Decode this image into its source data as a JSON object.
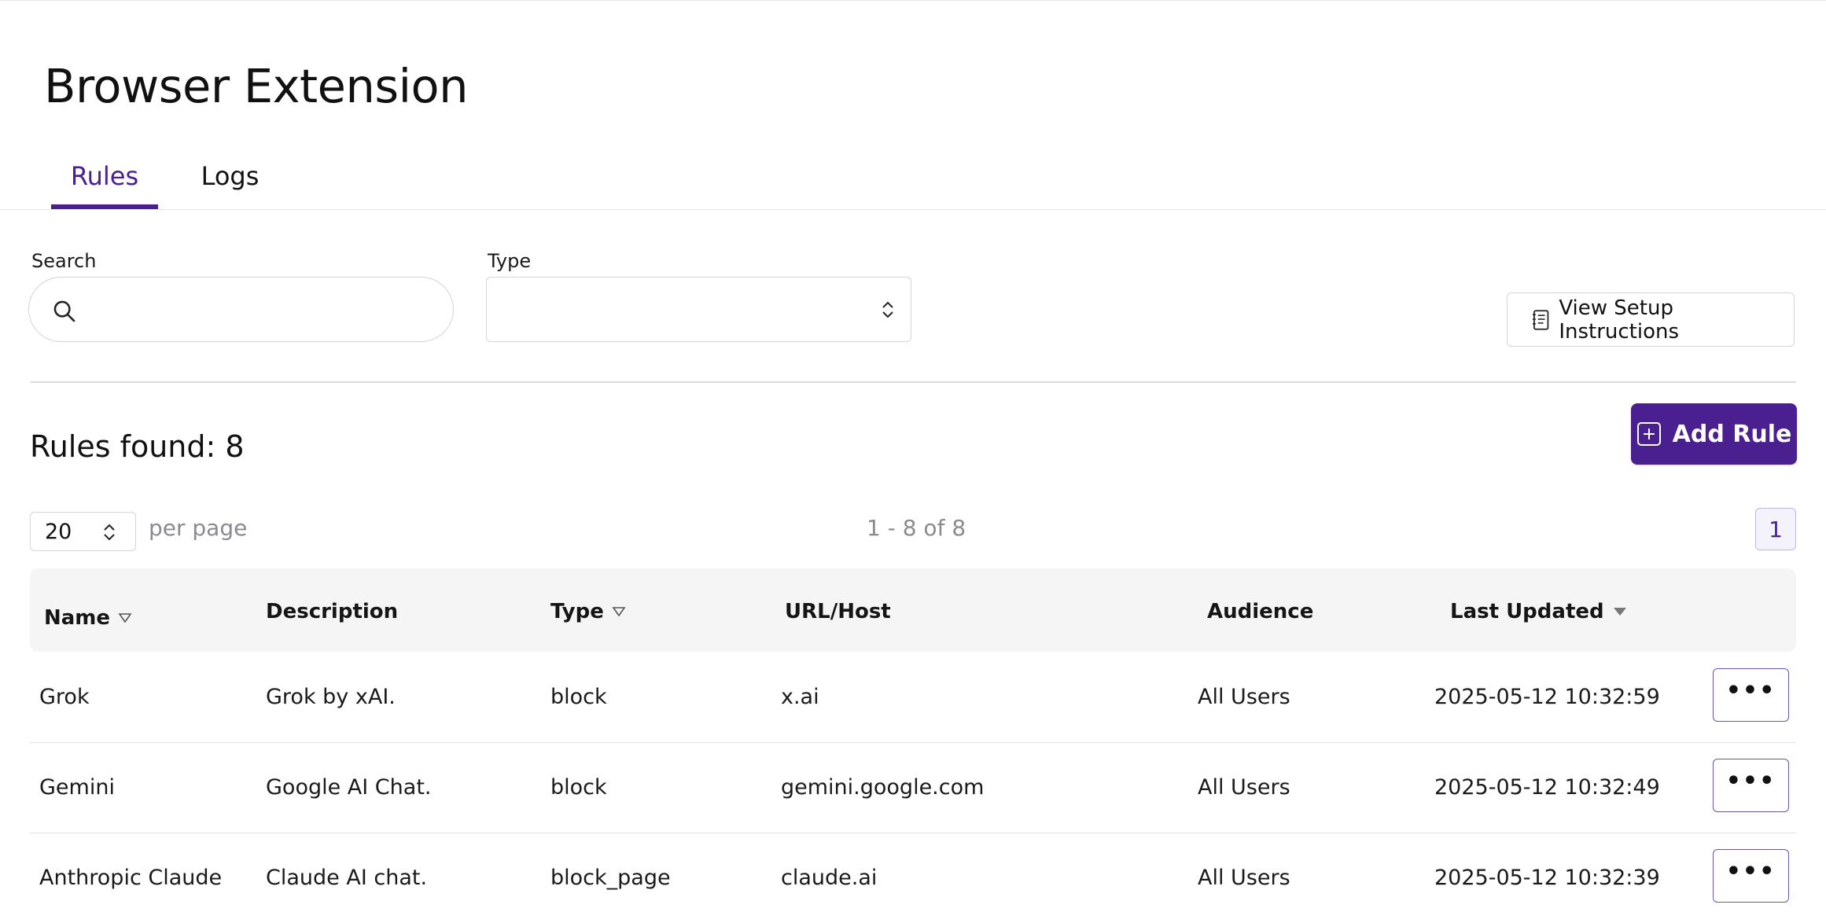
{
  "page": {
    "title": "Browser Extension"
  },
  "tabs": [
    {
      "label": "Rules",
      "active": true
    },
    {
      "label": "Logs",
      "active": false
    }
  ],
  "filters": {
    "search_label": "Search",
    "search_value": "",
    "type_label": "Type",
    "type_value": ""
  },
  "setup_button": {
    "label": "View Setup Instructions",
    "icon": "document-list-icon"
  },
  "summary": {
    "rules_found": "Rules found: 8"
  },
  "add_button": {
    "label": "Add Rule",
    "icon": "plus-square-icon"
  },
  "pagination": {
    "per_page": "20",
    "per_page_label": "per page",
    "range": "1 - 8 of 8",
    "current_page": "1"
  },
  "table": {
    "columns": [
      {
        "label": "Name",
        "sort": "filter"
      },
      {
        "label": "Description",
        "sort": "none"
      },
      {
        "label": "Type",
        "sort": "filter"
      },
      {
        "label": "URL/Host",
        "sort": "none"
      },
      {
        "label": "Audience",
        "sort": "none"
      },
      {
        "label": "Last Updated",
        "sort": "desc"
      }
    ],
    "rows": [
      {
        "name": "Grok",
        "description": "Grok by xAI.",
        "type": "block",
        "url": "x.ai",
        "audience": "All Users",
        "updated": "2025-05-12 10:32:59",
        "action": "•••"
      },
      {
        "name": "Gemini",
        "description": "Google AI Chat.",
        "type": "block",
        "url": "gemini.google.com",
        "audience": "All Users",
        "updated": "2025-05-12 10:32:49",
        "action": "•••"
      },
      {
        "name": "Anthropic Claude",
        "description": "Claude AI chat.",
        "type": "block_page",
        "url": "claude.ai",
        "audience": "All Users",
        "updated": "2025-05-12 10:32:39",
        "action": "•••"
      }
    ]
  },
  "colors": {
    "accent": "#4a2090",
    "header_bg": "#f5f5f6",
    "border": "#d4d4d9",
    "muted_text": "#8a8a90"
  }
}
